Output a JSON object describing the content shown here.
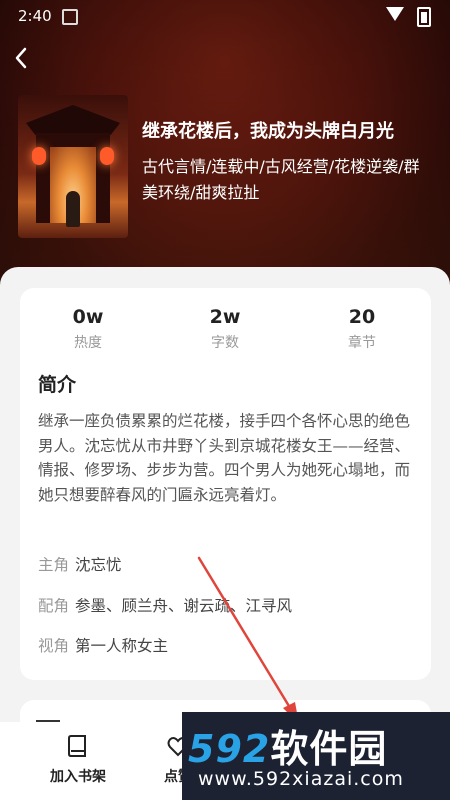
{
  "status_bar": {
    "time": "2:40"
  },
  "book": {
    "title": "继承花楼后，我成为头牌白月光",
    "tags": "古代言情/连载中/古风经营/花楼逆袭/群美环绕/甜爽拉扯"
  },
  "stats": [
    {
      "value": "0w",
      "label": "热度"
    },
    {
      "value": "2w",
      "label": "字数"
    },
    {
      "value": "20",
      "label": "章节"
    }
  ],
  "intro": {
    "heading": "简介",
    "text": "继承一座负债累累的烂花楼，接手四个各怀心思的绝色男人。沈忘忧从市井野丫头到京城花楼女王——经营、情报、修罗场、步步为营。四个男人为她死心塌地，而她只想要醉春风的门匾永远亮着灯。"
  },
  "meta": [
    {
      "key": "主角",
      "value": "沈忘忧"
    },
    {
      "key": "配角",
      "value": "参墨、顾兰舟、谢云疏、江寻风"
    },
    {
      "key": "视角",
      "value": "第一人称女主"
    }
  ],
  "bottom_bar": {
    "add_shelf": "加入书架",
    "like": "点赞"
  },
  "watermark": {
    "brand_num": "592",
    "brand_cn": "软件园",
    "url": "www.592xiazai.com"
  },
  "colors": {
    "accent": "#2aa3e6",
    "hero_dark": "#2a0a07"
  }
}
